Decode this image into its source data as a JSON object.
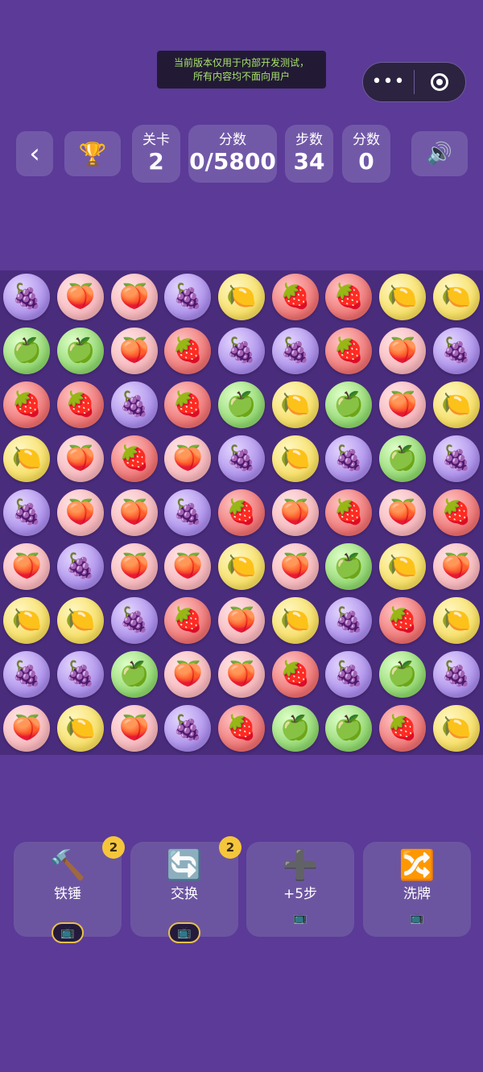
{
  "notice": {
    "line1": "当前版本仅用于内部开发测试，",
    "line2": "所有内容均不面向用户"
  },
  "capsule": {
    "more_icon": "more-dots-icon",
    "more_glyph": "•••",
    "close_icon": "target-close-icon"
  },
  "hud": {
    "back_glyph": "‹",
    "trophy_glyph": "🏆",
    "level_label": "关卡",
    "level_value": "2",
    "score_label": "分数",
    "score_value": "0/5800",
    "steps_label": "步数",
    "steps_value": "34",
    "points_label": "分数",
    "points_value": "0",
    "sound_glyph": "🔊"
  },
  "board": {
    "rows": 9,
    "cols": 9,
    "glyphs": {
      "grape": "🍇",
      "peach": "🍑",
      "lemon": "🍋",
      "strawberry": "🍓",
      "apple": "🍏"
    },
    "grid": [
      [
        "grape",
        "peach",
        "peach",
        "grape",
        "lemon",
        "strawberry",
        "strawberry",
        "lemon",
        "lemon"
      ],
      [
        "apple",
        "apple",
        "peach",
        "strawberry",
        "grape",
        "grape",
        "strawberry",
        "peach",
        "grape"
      ],
      [
        "strawberry",
        "strawberry",
        "grape",
        "strawberry",
        "apple",
        "lemon",
        "apple",
        "peach",
        "lemon"
      ],
      [
        "lemon",
        "peach",
        "strawberry",
        "peach",
        "grape",
        "lemon",
        "grape",
        "apple",
        "grape"
      ],
      [
        "grape",
        "peach",
        "peach",
        "grape",
        "strawberry",
        "peach",
        "strawberry",
        "peach",
        "strawberry"
      ],
      [
        "peach",
        "grape",
        "peach",
        "peach",
        "lemon",
        "peach",
        "apple",
        "lemon",
        "peach"
      ],
      [
        "lemon",
        "lemon",
        "grape",
        "strawberry",
        "peach",
        "lemon",
        "grape",
        "strawberry",
        "lemon"
      ],
      [
        "grape",
        "grape",
        "apple",
        "peach",
        "peach",
        "strawberry",
        "grape",
        "apple",
        "grape"
      ],
      [
        "peach",
        "lemon",
        "peach",
        "grape",
        "strawberry",
        "apple",
        "apple",
        "strawberry",
        "lemon"
      ]
    ]
  },
  "tools": [
    {
      "name": "hammer",
      "icon": "🔨",
      "label": "铁锤",
      "badge": "2",
      "ad": "📺"
    },
    {
      "name": "swap",
      "icon": "🔄",
      "label": "交换",
      "badge": "2",
      "ad": "📺"
    },
    {
      "name": "plus-steps",
      "icon": "➕",
      "label": "+5步",
      "badge": "",
      "ad": "📺"
    },
    {
      "name": "shuffle",
      "icon": "🔀",
      "label": "洗牌",
      "badge": "",
      "ad": "📺"
    }
  ]
}
